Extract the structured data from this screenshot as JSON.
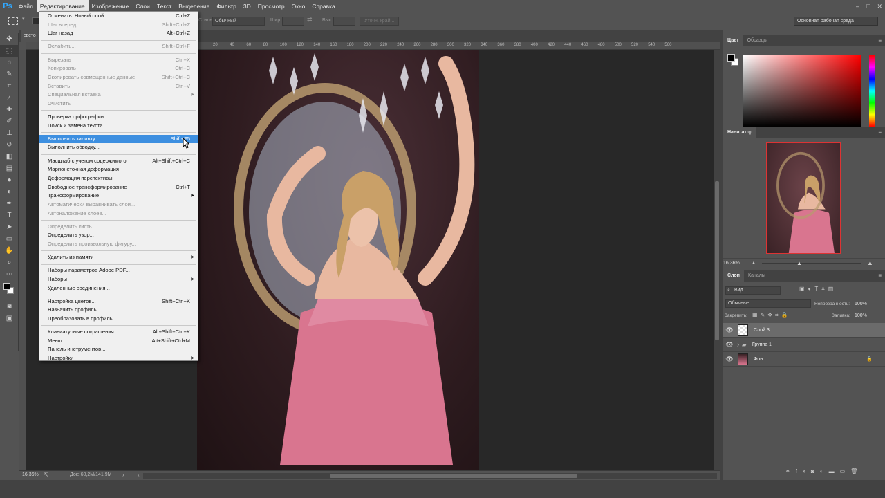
{
  "app": {
    "logo": "Ps"
  },
  "menubar": {
    "items": [
      "Файл",
      "Редактирование",
      "Изображение",
      "Слои",
      "Текст",
      "Выделение",
      "Фильтр",
      "3D",
      "Просмотр",
      "Окно",
      "Справка"
    ],
    "active_index": 1
  },
  "options": {
    "mode_label": "Стиль:",
    "mode_value": "Обычный",
    "width_label": "Шир.:",
    "height_label": "Выс.:",
    "refine_button": "Уточн. край...",
    "workspace": "Основная рабочая среда"
  },
  "document": {
    "tab_name": "свето",
    "zoom": "16,36%",
    "doc_info": "Док: 60,2M/141,9M"
  },
  "ruler": {
    "ticks": [
      "20",
      "40",
      "60",
      "80",
      "100",
      "120",
      "140",
      "160",
      "180",
      "200",
      "220",
      "240",
      "260",
      "280",
      "300",
      "320",
      "340",
      "360",
      "380",
      "400",
      "420",
      "440",
      "460",
      "480",
      "500",
      "520",
      "540",
      "560"
    ]
  },
  "edit_menu": [
    {
      "label": "Отменить: Новый слой",
      "shortcut": "Ctrl+Z",
      "enabled": true
    },
    {
      "label": "Шаг вперед",
      "shortcut": "Shift+Ctrl+Z",
      "enabled": false
    },
    {
      "label": "Шаг назад",
      "shortcut": "Alt+Ctrl+Z",
      "enabled": true
    },
    {
      "sep": true
    },
    {
      "label": "Ослабить...",
      "shortcut": "Shift+Ctrl+F",
      "enabled": false
    },
    {
      "sep": true
    },
    {
      "label": "Вырезать",
      "shortcut": "Ctrl+X",
      "enabled": false
    },
    {
      "label": "Копировать",
      "shortcut": "Ctrl+C",
      "enabled": false
    },
    {
      "label": "Скопировать совмещенные данные",
      "shortcut": "Shift+Ctrl+C",
      "enabled": false
    },
    {
      "label": "Вставить",
      "shortcut": "Ctrl+V",
      "enabled": false
    },
    {
      "label": "Специальная вставка",
      "shortcut": "",
      "enabled": false,
      "submenu": true
    },
    {
      "label": "Очистить",
      "shortcut": "",
      "enabled": false
    },
    {
      "sep": true
    },
    {
      "label": "Проверка орфографии...",
      "shortcut": "",
      "enabled": true
    },
    {
      "label": "Поиск и замена текста...",
      "shortcut": "",
      "enabled": true
    },
    {
      "sep": true
    },
    {
      "label": "Выполнить заливку...",
      "shortcut": "Shift+F5",
      "enabled": true,
      "highlight": true
    },
    {
      "label": "Выполнить обводку...",
      "shortcut": "",
      "enabled": true
    },
    {
      "sep": true
    },
    {
      "label": "Масштаб с учетом содержимого",
      "shortcut": "Alt+Shift+Ctrl+C",
      "enabled": true
    },
    {
      "label": "Марионеточная деформация",
      "shortcut": "",
      "enabled": true
    },
    {
      "label": "Деформация перспективы",
      "shortcut": "",
      "enabled": true
    },
    {
      "label": "Свободное трансформирование",
      "shortcut": "Ctrl+T",
      "enabled": true
    },
    {
      "label": "Трансформирование",
      "shortcut": "",
      "enabled": true,
      "submenu": true
    },
    {
      "label": "Автоматически выравнивать слои...",
      "shortcut": "",
      "enabled": false
    },
    {
      "label": "Автоналожение слоев...",
      "shortcut": "",
      "enabled": false
    },
    {
      "sep": true
    },
    {
      "label": "Определить кисть...",
      "shortcut": "",
      "enabled": false
    },
    {
      "label": "Определить узор...",
      "shortcut": "",
      "enabled": true
    },
    {
      "label": "Определить произвольную фигуру...",
      "shortcut": "",
      "enabled": false
    },
    {
      "sep": true
    },
    {
      "label": "Удалить из памяти",
      "shortcut": "",
      "enabled": true,
      "submenu": true
    },
    {
      "sep": true
    },
    {
      "label": "Наборы параметров Adobe PDF...",
      "shortcut": "",
      "enabled": true
    },
    {
      "label": "Наборы",
      "shortcut": "",
      "enabled": true,
      "submenu": true
    },
    {
      "label": "Удаленные соединения...",
      "shortcut": "",
      "enabled": true
    },
    {
      "sep": true
    },
    {
      "label": "Настройка цветов...",
      "shortcut": "Shift+Ctrl+K",
      "enabled": true
    },
    {
      "label": "Назначить профиль...",
      "shortcut": "",
      "enabled": true
    },
    {
      "label": "Преобразовать в профиль...",
      "shortcut": "",
      "enabled": true
    },
    {
      "sep": true
    },
    {
      "label": "Клавиатурные сокращения...",
      "shortcut": "Alt+Shift+Ctrl+K",
      "enabled": true
    },
    {
      "label": "Меню...",
      "shortcut": "Alt+Shift+Ctrl+M",
      "enabled": true
    },
    {
      "label": "Панель инструментов...",
      "shortcut": "",
      "enabled": true
    },
    {
      "label": "Настройки",
      "shortcut": "",
      "enabled": true,
      "submenu": true
    }
  ],
  "color_panel": {
    "tabs": [
      "Цвет",
      "Образцы"
    ]
  },
  "navigator": {
    "title": "Навигатор",
    "zoom": "16,36%"
  },
  "layers_panel": {
    "tabs": [
      "Слои",
      "Каналы"
    ],
    "filter": "Вид",
    "blend_mode": "Обычные",
    "opacity_label": "Непрозрачность:",
    "opacity_value": "100%",
    "lock_label": "Закрепить:",
    "fill_label": "Заливка:",
    "fill_value": "100%",
    "layers": [
      {
        "name": "Слой 3",
        "selected": true,
        "type": "layer"
      },
      {
        "name": "Группа 1",
        "selected": false,
        "type": "group"
      },
      {
        "name": "Фон",
        "selected": false,
        "type": "background",
        "locked": true
      }
    ]
  }
}
